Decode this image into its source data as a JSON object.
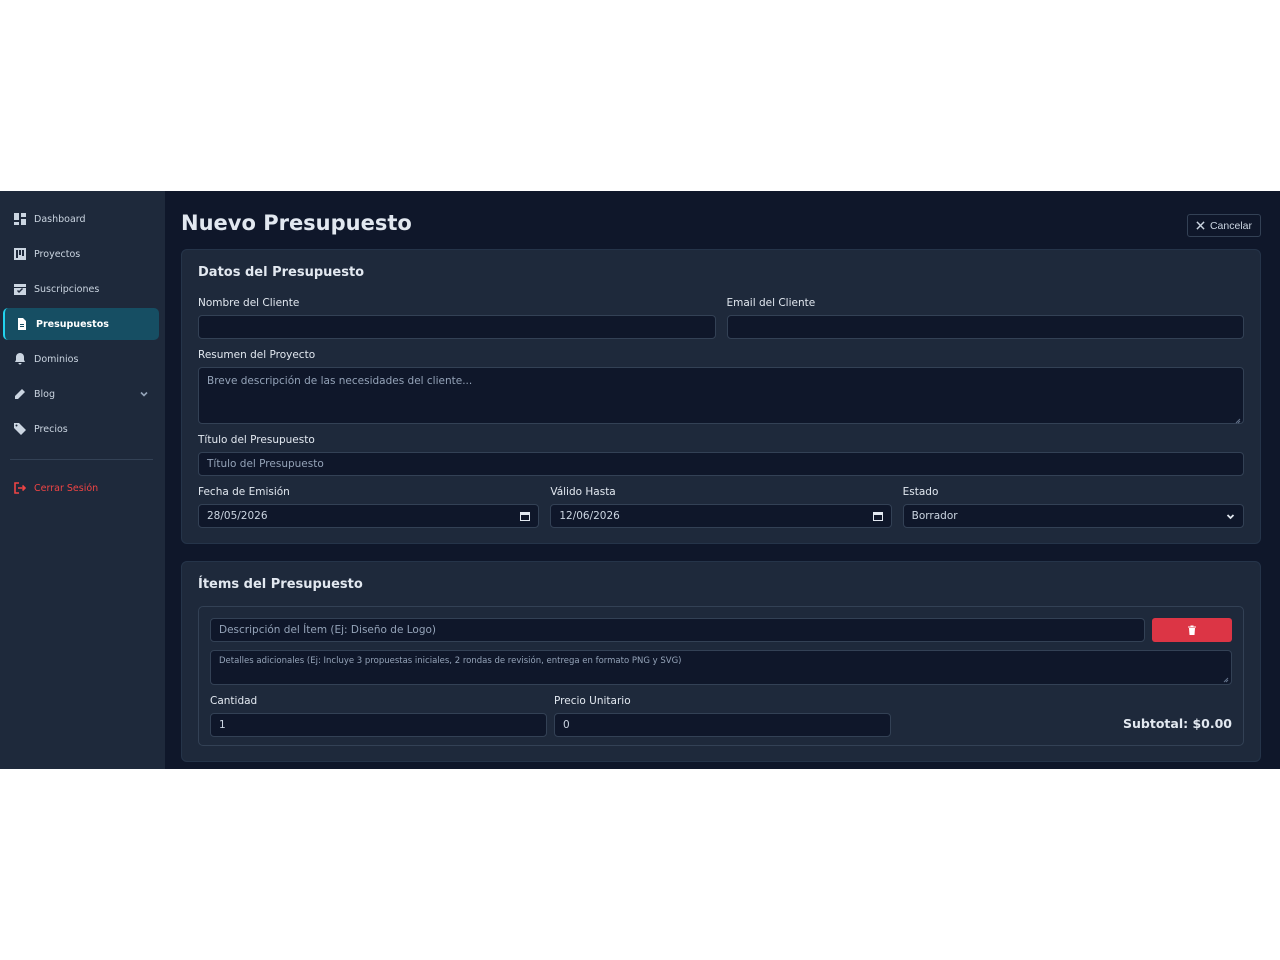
{
  "sidebar": {
    "items": [
      {
        "label": "Dashboard",
        "icon": "dashboard-icon"
      },
      {
        "label": "Proyectos",
        "icon": "projects-icon"
      },
      {
        "label": "Suscripciones",
        "icon": "calendar-check-icon"
      },
      {
        "label": "Presupuestos",
        "icon": "document-icon",
        "active": true
      },
      {
        "label": "Dominios",
        "icon": "bell-icon"
      },
      {
        "label": "Blog",
        "icon": "pencil-icon",
        "has_submenu": true
      },
      {
        "label": "Precios",
        "icon": "tags-icon"
      }
    ],
    "logout_label": "Cerrar Sesión"
  },
  "header": {
    "title": "Nuevo Presupuesto",
    "cancel_label": "Cancelar"
  },
  "datos": {
    "title": "Datos del Presupuesto",
    "client_name_label": "Nombre del Cliente",
    "client_name_value": "",
    "client_email_label": "Email del Cliente",
    "client_email_value": "",
    "summary_label": "Resumen del Proyecto",
    "summary_placeholder": "Breve descripción de las necesidades del cliente...",
    "title_label": "Título del Presupuesto",
    "title_placeholder": "Título del Presupuesto",
    "issue_date_label": "Fecha de Emisión",
    "issue_date_value": "28/05/2026",
    "valid_until_label": "Válido Hasta",
    "valid_until_value": "12/06/2026",
    "status_label": "Estado",
    "status_value": "Borrador"
  },
  "items": {
    "title": "Ítems del Presupuesto",
    "item_desc_placeholder": "Descripción del Ítem (Ej: Diseño de Logo)",
    "item_details_placeholder": "Detalles adicionales (Ej: Incluye 3 propuestas iniciales, 2 rondas de revisión, entrega en formato PNG y SVG)",
    "quantity_label": "Cantidad",
    "quantity_value": "1",
    "unit_price_label": "Precio Unitario",
    "unit_price_value": "0",
    "subtotal": "Subtotal: $0.00"
  },
  "colors": {
    "accent": "#22d3ee",
    "danger": "#dc3545",
    "background": "#0f172a",
    "surface": "#1e293b"
  }
}
